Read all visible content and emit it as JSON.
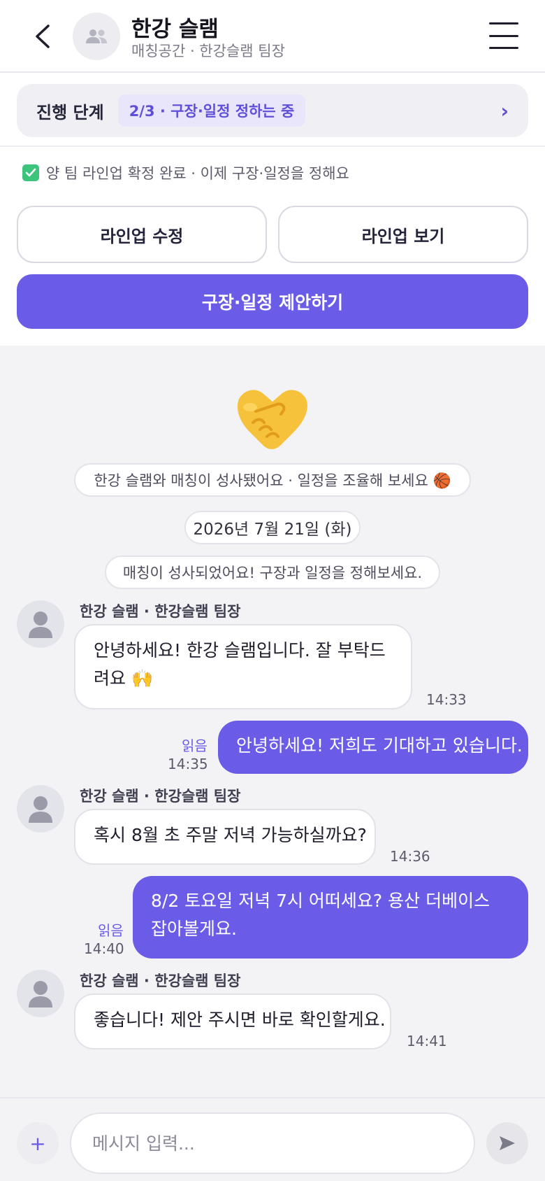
{
  "header": {
    "title": "한강 슬램",
    "subtitle": "매칭공간 · 한강슬램 팀장"
  },
  "progress": {
    "label": "진행 단계",
    "step": "2/3 · 구장·일정 정하는 중",
    "chevron": "›"
  },
  "notice": {
    "text": "양 팀 라인업 확정 완료 · 이제 구장·일정을 정해요",
    "icon": "check-icon"
  },
  "actions": {
    "edit_lineup": "라인업 수정",
    "view_lineup": "라인업 보기",
    "propose": "구장·일정 제안하기"
  },
  "chat": {
    "system_message": "한강 슬램와 매칭이 성사됐어요 · 일정을 조율해 보세요 🏀",
    "date": "2026년 7월 21일 (화)",
    "match_notice": "매칭이 성사되었어요! 구장과 일정을 정해보세요.",
    "messages": [
      {
        "sender": "한강 슬램 · 한강슬램 팀장",
        "text": "안녕하세요! 한강 슬램입니다. 잘 부탁드려요 🙌",
        "time": "14:33"
      },
      {
        "text": "안녕하세요! 저희도 기대하고 있습니다.",
        "time": "14:35",
        "read": "읽음"
      },
      {
        "sender": "한강 슬램 · 한강슬램 팀장",
        "text": "혹시 8월 초 주말 저녁 가능하실까요?",
        "time": "14:36"
      },
      {
        "text": "8/2 토요일 저녁 7시 어떠세요? 용산 더베이스 잡아볼게요.",
        "time": "14:40",
        "read": "읽음"
      },
      {
        "sender": "한강 슬램 · 한강슬램 팀장",
        "text": "좋습니다! 제안 주시면 바로 확인할게요.",
        "time": "14:41"
      }
    ]
  },
  "composer": {
    "placeholder": "메시지 입력...",
    "plus": "+"
  },
  "colors": {
    "accent": "#6b5ce7",
    "success": "#3cc47c"
  }
}
